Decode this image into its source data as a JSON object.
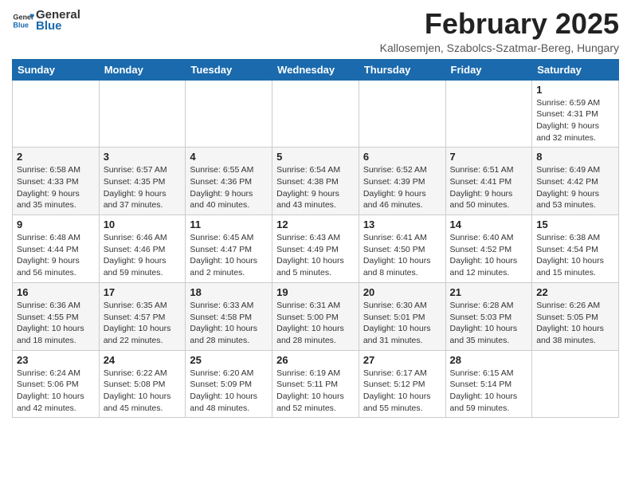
{
  "header": {
    "logo_general": "General",
    "logo_blue": "Blue",
    "month_title": "February 2025",
    "location": "Kallosemjen, Szabolcs-Szatmar-Bereg, Hungary"
  },
  "weekdays": [
    "Sunday",
    "Monday",
    "Tuesday",
    "Wednesday",
    "Thursday",
    "Friday",
    "Saturday"
  ],
  "weeks": [
    [
      {
        "day": "",
        "info": ""
      },
      {
        "day": "",
        "info": ""
      },
      {
        "day": "",
        "info": ""
      },
      {
        "day": "",
        "info": ""
      },
      {
        "day": "",
        "info": ""
      },
      {
        "day": "",
        "info": ""
      },
      {
        "day": "1",
        "info": "Sunrise: 6:59 AM\nSunset: 4:31 PM\nDaylight: 9 hours and 32 minutes."
      }
    ],
    [
      {
        "day": "2",
        "info": "Sunrise: 6:58 AM\nSunset: 4:33 PM\nDaylight: 9 hours and 35 minutes."
      },
      {
        "day": "3",
        "info": "Sunrise: 6:57 AM\nSunset: 4:35 PM\nDaylight: 9 hours and 37 minutes."
      },
      {
        "day": "4",
        "info": "Sunrise: 6:55 AM\nSunset: 4:36 PM\nDaylight: 9 hours and 40 minutes."
      },
      {
        "day": "5",
        "info": "Sunrise: 6:54 AM\nSunset: 4:38 PM\nDaylight: 9 hours and 43 minutes."
      },
      {
        "day": "6",
        "info": "Sunrise: 6:52 AM\nSunset: 4:39 PM\nDaylight: 9 hours and 46 minutes."
      },
      {
        "day": "7",
        "info": "Sunrise: 6:51 AM\nSunset: 4:41 PM\nDaylight: 9 hours and 50 minutes."
      },
      {
        "day": "8",
        "info": "Sunrise: 6:49 AM\nSunset: 4:42 PM\nDaylight: 9 hours and 53 minutes."
      }
    ],
    [
      {
        "day": "9",
        "info": "Sunrise: 6:48 AM\nSunset: 4:44 PM\nDaylight: 9 hours and 56 minutes."
      },
      {
        "day": "10",
        "info": "Sunrise: 6:46 AM\nSunset: 4:46 PM\nDaylight: 9 hours and 59 minutes."
      },
      {
        "day": "11",
        "info": "Sunrise: 6:45 AM\nSunset: 4:47 PM\nDaylight: 10 hours and 2 minutes."
      },
      {
        "day": "12",
        "info": "Sunrise: 6:43 AM\nSunset: 4:49 PM\nDaylight: 10 hours and 5 minutes."
      },
      {
        "day": "13",
        "info": "Sunrise: 6:41 AM\nSunset: 4:50 PM\nDaylight: 10 hours and 8 minutes."
      },
      {
        "day": "14",
        "info": "Sunrise: 6:40 AM\nSunset: 4:52 PM\nDaylight: 10 hours and 12 minutes."
      },
      {
        "day": "15",
        "info": "Sunrise: 6:38 AM\nSunset: 4:54 PM\nDaylight: 10 hours and 15 minutes."
      }
    ],
    [
      {
        "day": "16",
        "info": "Sunrise: 6:36 AM\nSunset: 4:55 PM\nDaylight: 10 hours and 18 minutes."
      },
      {
        "day": "17",
        "info": "Sunrise: 6:35 AM\nSunset: 4:57 PM\nDaylight: 10 hours and 22 minutes."
      },
      {
        "day": "18",
        "info": "Sunrise: 6:33 AM\nSunset: 4:58 PM\nDaylight: 10 hours and 28 minutes."
      },
      {
        "day": "19",
        "info": "Sunrise: 6:31 AM\nSunset: 5:00 PM\nDaylight: 10 hours and 28 minutes."
      },
      {
        "day": "20",
        "info": "Sunrise: 6:30 AM\nSunset: 5:01 PM\nDaylight: 10 hours and 31 minutes."
      },
      {
        "day": "21",
        "info": "Sunrise: 6:28 AM\nSunset: 5:03 PM\nDaylight: 10 hours and 35 minutes."
      },
      {
        "day": "22",
        "info": "Sunrise: 6:26 AM\nSunset: 5:05 PM\nDaylight: 10 hours and 38 minutes."
      }
    ],
    [
      {
        "day": "23",
        "info": "Sunrise: 6:24 AM\nSunset: 5:06 PM\nDaylight: 10 hours and 42 minutes."
      },
      {
        "day": "24",
        "info": "Sunrise: 6:22 AM\nSunset: 5:08 PM\nDaylight: 10 hours and 45 minutes."
      },
      {
        "day": "25",
        "info": "Sunrise: 6:20 AM\nSunset: 5:09 PM\nDaylight: 10 hours and 48 minutes."
      },
      {
        "day": "26",
        "info": "Sunrise: 6:19 AM\nSunset: 5:11 PM\nDaylight: 10 hours and 52 minutes."
      },
      {
        "day": "27",
        "info": "Sunrise: 6:17 AM\nSunset: 5:12 PM\nDaylight: 10 hours and 55 minutes."
      },
      {
        "day": "28",
        "info": "Sunrise: 6:15 AM\nSunset: 5:14 PM\nDaylight: 10 hours and 59 minutes."
      },
      {
        "day": "",
        "info": ""
      }
    ]
  ]
}
